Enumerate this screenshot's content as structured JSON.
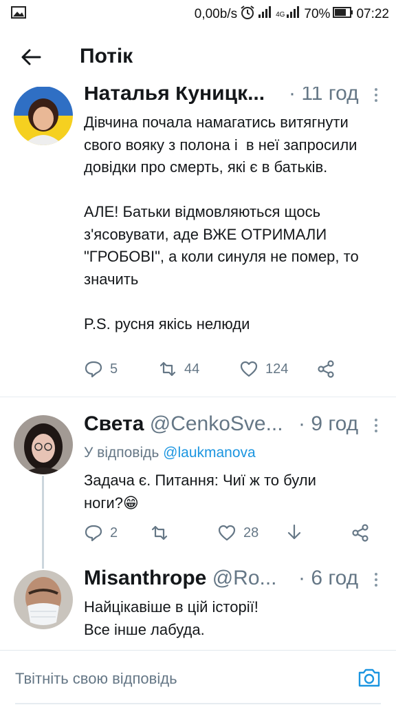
{
  "status_bar": {
    "speed": "0,00b/s",
    "network": "4G",
    "battery": "70%",
    "time": "07:22"
  },
  "header": {
    "title": "Потік"
  },
  "tweets": [
    {
      "name": "Наталья Куницк...",
      "handle": "",
      "time": "· 11 год",
      "text": "Дівчина почала намагатись витягнути свого вояку з полона і  в неї запросили довідки про смерть, які є в батьків.\n\nАЛЕ! Батьки відмовляються щось з'ясовувати, аде ВЖЕ ОТРИМАЛИ \"ГРОБОВІ\", а коли синуля не помер, то значить\n\nP.S. русня якісь нелюди",
      "replies": "5",
      "retweets": "44",
      "likes": "124"
    },
    {
      "name": "Света",
      "handle": "@CenkoSve...",
      "time": "· 9 год",
      "reply_prefix": "У відповідь",
      "reply_to": "@laukmanova",
      "text": "Задача є. Питання: Чиї ж то були ноги?😁",
      "replies": "2",
      "retweets": "",
      "likes": "28"
    },
    {
      "name": "Misanthrope",
      "handle": "@Ro...",
      "time": "· 6 год",
      "text": "Найцікавіше в цій історії!\nВсе інше лабуда."
    }
  ],
  "reply_bar": {
    "placeholder": "Твітніть свою відповідь"
  },
  "colors": {
    "accent": "#1b95e0",
    "muted": "#657786",
    "divider": "#e6ecf0"
  }
}
